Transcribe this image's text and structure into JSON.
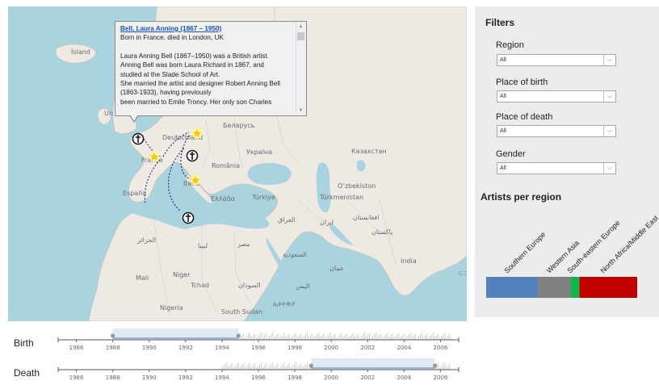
{
  "map": {
    "labels": {
      "island": "Ísland",
      "uk": "Un",
      "belarus": "Беларусь",
      "deutschland": "Deutschland",
      "ukraina": "Україна",
      "kazakhstan": "Казахстан",
      "france": "France",
      "romania": "România",
      "espana": "España",
      "italia": "Italia",
      "ellada": "Ελλάδα",
      "turkiye": "Türkiye",
      "ozbekiston": "O‘zbekiston",
      "turkmenistan": "Türkmenistan",
      "iraq": "العراق",
      "iran": "ایران",
      "afghanistan": "افغانستان",
      "pakistan": "پاکستان",
      "algeria": "الجزائر",
      "libya": "ليبيا",
      "egypt": "مصر",
      "saudi": "السعودية",
      "oman": "عمان",
      "india": "India",
      "yemen": "اليمن",
      "mali": "Mali",
      "niger": "Niger",
      "tchad": "Tchad",
      "sudan": "السودان",
      "nigeria": "Nigeria",
      "south_sudan": "South Sudan",
      "ethiopia": "ኢትዮጵያ"
    }
  },
  "popup": {
    "title": "Bell, Laura Anning (1867 – 1950)",
    "subtitle": "Born in France, died in London, UK",
    "lines": [
      "Laura Anning Bell (1867–1950) was a British artist.",
      "Anning Bell was born Laura Richard in 1867, and",
      "studied at the Slade School of Art.",
      "She married the artist and designer Robert Anning Bell",
      "(1863-1933), having previously",
      "been married to Emile Troncy. Her only son Charles"
    ]
  },
  "filters": {
    "title": "Filters",
    "region": {
      "label": "Region",
      "value": "All"
    },
    "birth": {
      "label": "Place of birth",
      "value": "All"
    },
    "death": {
      "label": "Place of death",
      "value": "All"
    },
    "gender": {
      "label": "Gender",
      "value": "All"
    }
  },
  "artists_chart": {
    "title": "Artists per region",
    "icon": "stacked-bar"
  },
  "chart_data": {
    "type": "bar",
    "stacked": true,
    "title": "Artists per region",
    "categories": [
      "Southern Europe",
      "Western Asia",
      "South-eastern Europe",
      "North Africa/Middle East"
    ],
    "values": [
      35,
      22,
      6,
      39
    ],
    "colors": [
      "#5281bc",
      "#808080",
      "#13b34e",
      "#c10000"
    ]
  },
  "timeline": {
    "birth": {
      "label": "Birth",
      "ticks": [
        "1986",
        "1988",
        "1990",
        "1992",
        "1994",
        "1996",
        "1998",
        "2000",
        "2002",
        "2004",
        "2006"
      ],
      "selection": [
        1988,
        1994.9
      ]
    },
    "death": {
      "label": "Death",
      "ticks": [
        "1986",
        "1988",
        "1990",
        "1992",
        "1994",
        "1996",
        "1998",
        "2000",
        "2002",
        "2004",
        "2006"
      ],
      "selection": [
        1998.9,
        2005.7
      ]
    }
  }
}
